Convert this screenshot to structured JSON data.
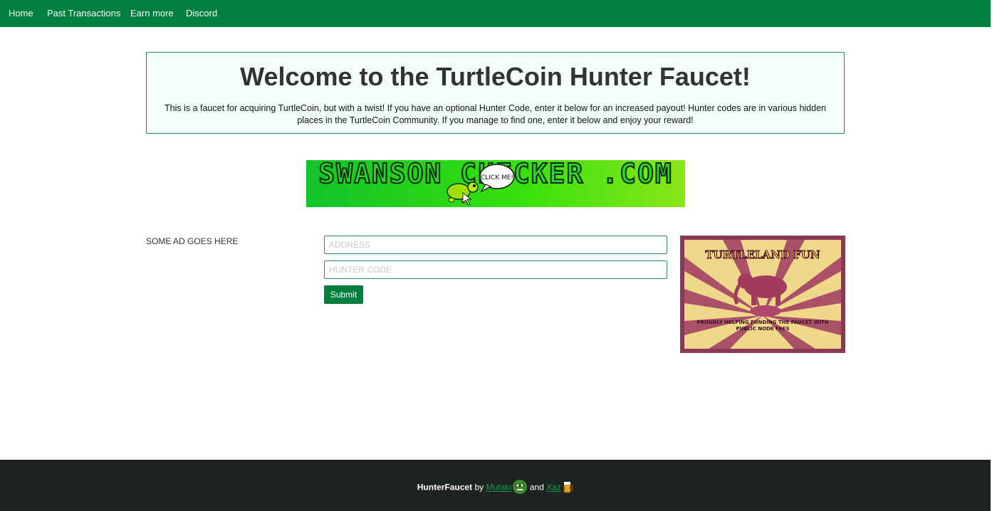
{
  "nav": {
    "items": [
      "Home",
      "Past Transactions",
      "Earn more",
      "Discord"
    ]
  },
  "hero": {
    "title": "Welcome to the TurtleCoin Hunter Faucet!",
    "description": "This is a faucet for acquiring TurtleCoin, but with a twist! If you have an optional Hunter Code, enter it below for an increased payout! Hunter codes are in various hidden places in the TurtleCoin Community. If you manage to find one, enter it below and enjoy your reward!"
  },
  "banner": {
    "text": "SWANSON CHECKER .COM",
    "bubble": "CLICK ME!"
  },
  "left_ad": {
    "text": "SOME AD GOES HERE"
  },
  "form": {
    "address_placeholder": "ADDRESS",
    "address_value": "",
    "hunter_placeholder": "HUNTER CODE",
    "hunter_value": "",
    "submit_label": "Submit"
  },
  "poster": {
    "title": "TURTLELAND FUN",
    "caption_line1": "PROUDLY HELPING FUNDING THE FAUCET WITH",
    "caption_line2": "PUBLIC NODE FEES"
  },
  "footer": {
    "brand": "HunterFaucet",
    "by": "by",
    "author1": "Mufalo",
    "and": "and",
    "author2": "Xaz"
  },
  "colors": {
    "nav_bg": "#007f3f",
    "hero_bg": "#f3fdf9",
    "accent": "#1f8a55",
    "footer_bg": "#1e231f",
    "link": "#13a050"
  },
  "icons": [
    "turtle-icon",
    "hulk-icon",
    "beer-icon"
  ]
}
